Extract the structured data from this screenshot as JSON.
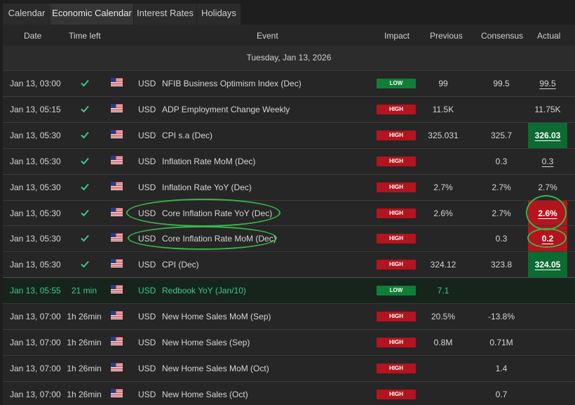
{
  "tabs": [
    "Calendar",
    "Economic Calendar",
    "Interest Rates",
    "Holidays"
  ],
  "active_tab": "Economic Calendar",
  "columns": {
    "date": "Date",
    "time_left": "Time left",
    "event": "Event",
    "impact": "Impact",
    "previous": "Previous",
    "consensus": "Consensus",
    "actual": "Actual"
  },
  "date_header": "Tuesday, Jan 13, 2026",
  "rows": [
    {
      "date": "Jan 13, 03:00",
      "time_left": "",
      "currency": "USD",
      "event": "NFIB Business Optimism Index (Dec)",
      "impact": "LOW",
      "previous": "99",
      "consensus": "99.5",
      "actual": "99.5"
    },
    {
      "date": "Jan 13, 05:15",
      "time_left": "",
      "currency": "USD",
      "event": "ADP Employment Change Weekly",
      "impact": "HIGH",
      "previous": "11.5K",
      "consensus": "",
      "actual": "11.75K"
    },
    {
      "date": "Jan 13, 05:30",
      "time_left": "",
      "currency": "USD",
      "event": "CPI s.a (Dec)",
      "impact": "HIGH",
      "previous": "325.031",
      "consensus": "325.7",
      "actual": "326.03"
    },
    {
      "date": "Jan 13, 05:30",
      "time_left": "",
      "currency": "USD",
      "event": "Inflation Rate MoM (Dec)",
      "impact": "HIGH",
      "previous": "",
      "consensus": "0.3",
      "actual": "0.3"
    },
    {
      "date": "Jan 13, 05:30",
      "time_left": "",
      "currency": "USD",
      "event": "Inflation Rate YoY (Dec)",
      "impact": "HIGH",
      "previous": "2.7%",
      "consensus": "2.7%",
      "actual": "2.7%"
    },
    {
      "date": "Jan 13, 05:30",
      "time_left": "",
      "currency": "USD",
      "event": "Core Inflation Rate YoY (Dec)",
      "impact": "HIGH",
      "previous": "2.6%",
      "consensus": "2.7%",
      "actual": "2.6%"
    },
    {
      "date": "Jan 13, 05:30",
      "time_left": "",
      "currency": "USD",
      "event": "Core Inflation Rate MoM (Dec)",
      "impact": "HIGH",
      "previous": "",
      "consensus": "0.3",
      "actual": "0.2"
    },
    {
      "date": "Jan 13, 05:30",
      "time_left": "",
      "currency": "USD",
      "event": "CPI (Dec)",
      "impact": "HIGH",
      "previous": "324.12",
      "consensus": "323.8",
      "actual": "324.05"
    },
    {
      "date": "Jan 13, 05:55",
      "time_left": "21 min",
      "currency": "USD",
      "event": "Redbook YoY (Jan/10)",
      "impact": "LOW",
      "previous": "7.1",
      "consensus": "",
      "actual": ""
    },
    {
      "date": "Jan 13, 07:00",
      "time_left": "1h 26min",
      "currency": "USD",
      "event": "New Home Sales MoM (Sep)",
      "impact": "HIGH",
      "previous": "20.5%",
      "consensus": "-13.8%",
      "actual": ""
    },
    {
      "date": "Jan 13, 07:00",
      "time_left": "1h 26min",
      "currency": "USD",
      "event": "New Home Sales (Sep)",
      "impact": "HIGH",
      "previous": "0.8M",
      "consensus": "0.71M",
      "actual": ""
    },
    {
      "date": "Jan 13, 07:00",
      "time_left": "1h 26min",
      "currency": "USD",
      "event": "New Home Sales MoM (Oct)",
      "impact": "HIGH",
      "previous": "",
      "consensus": "1.4",
      "actual": ""
    },
    {
      "date": "Jan 13, 07:00",
      "time_left": "1h 26min",
      "currency": "USD",
      "event": "New Home Sales (Oct)",
      "impact": "HIGH",
      "previous": "",
      "consensus": "0.7",
      "actual": ""
    }
  ],
  "colors": {
    "background": "#262626",
    "impact_low": "#0e7f35",
    "impact_high": "#b3141d",
    "actual_better": "#0b6b33",
    "actual_worse": "#b3141d",
    "check_mark": "#3fc88a",
    "highlight_ring": "#39b54a"
  }
}
